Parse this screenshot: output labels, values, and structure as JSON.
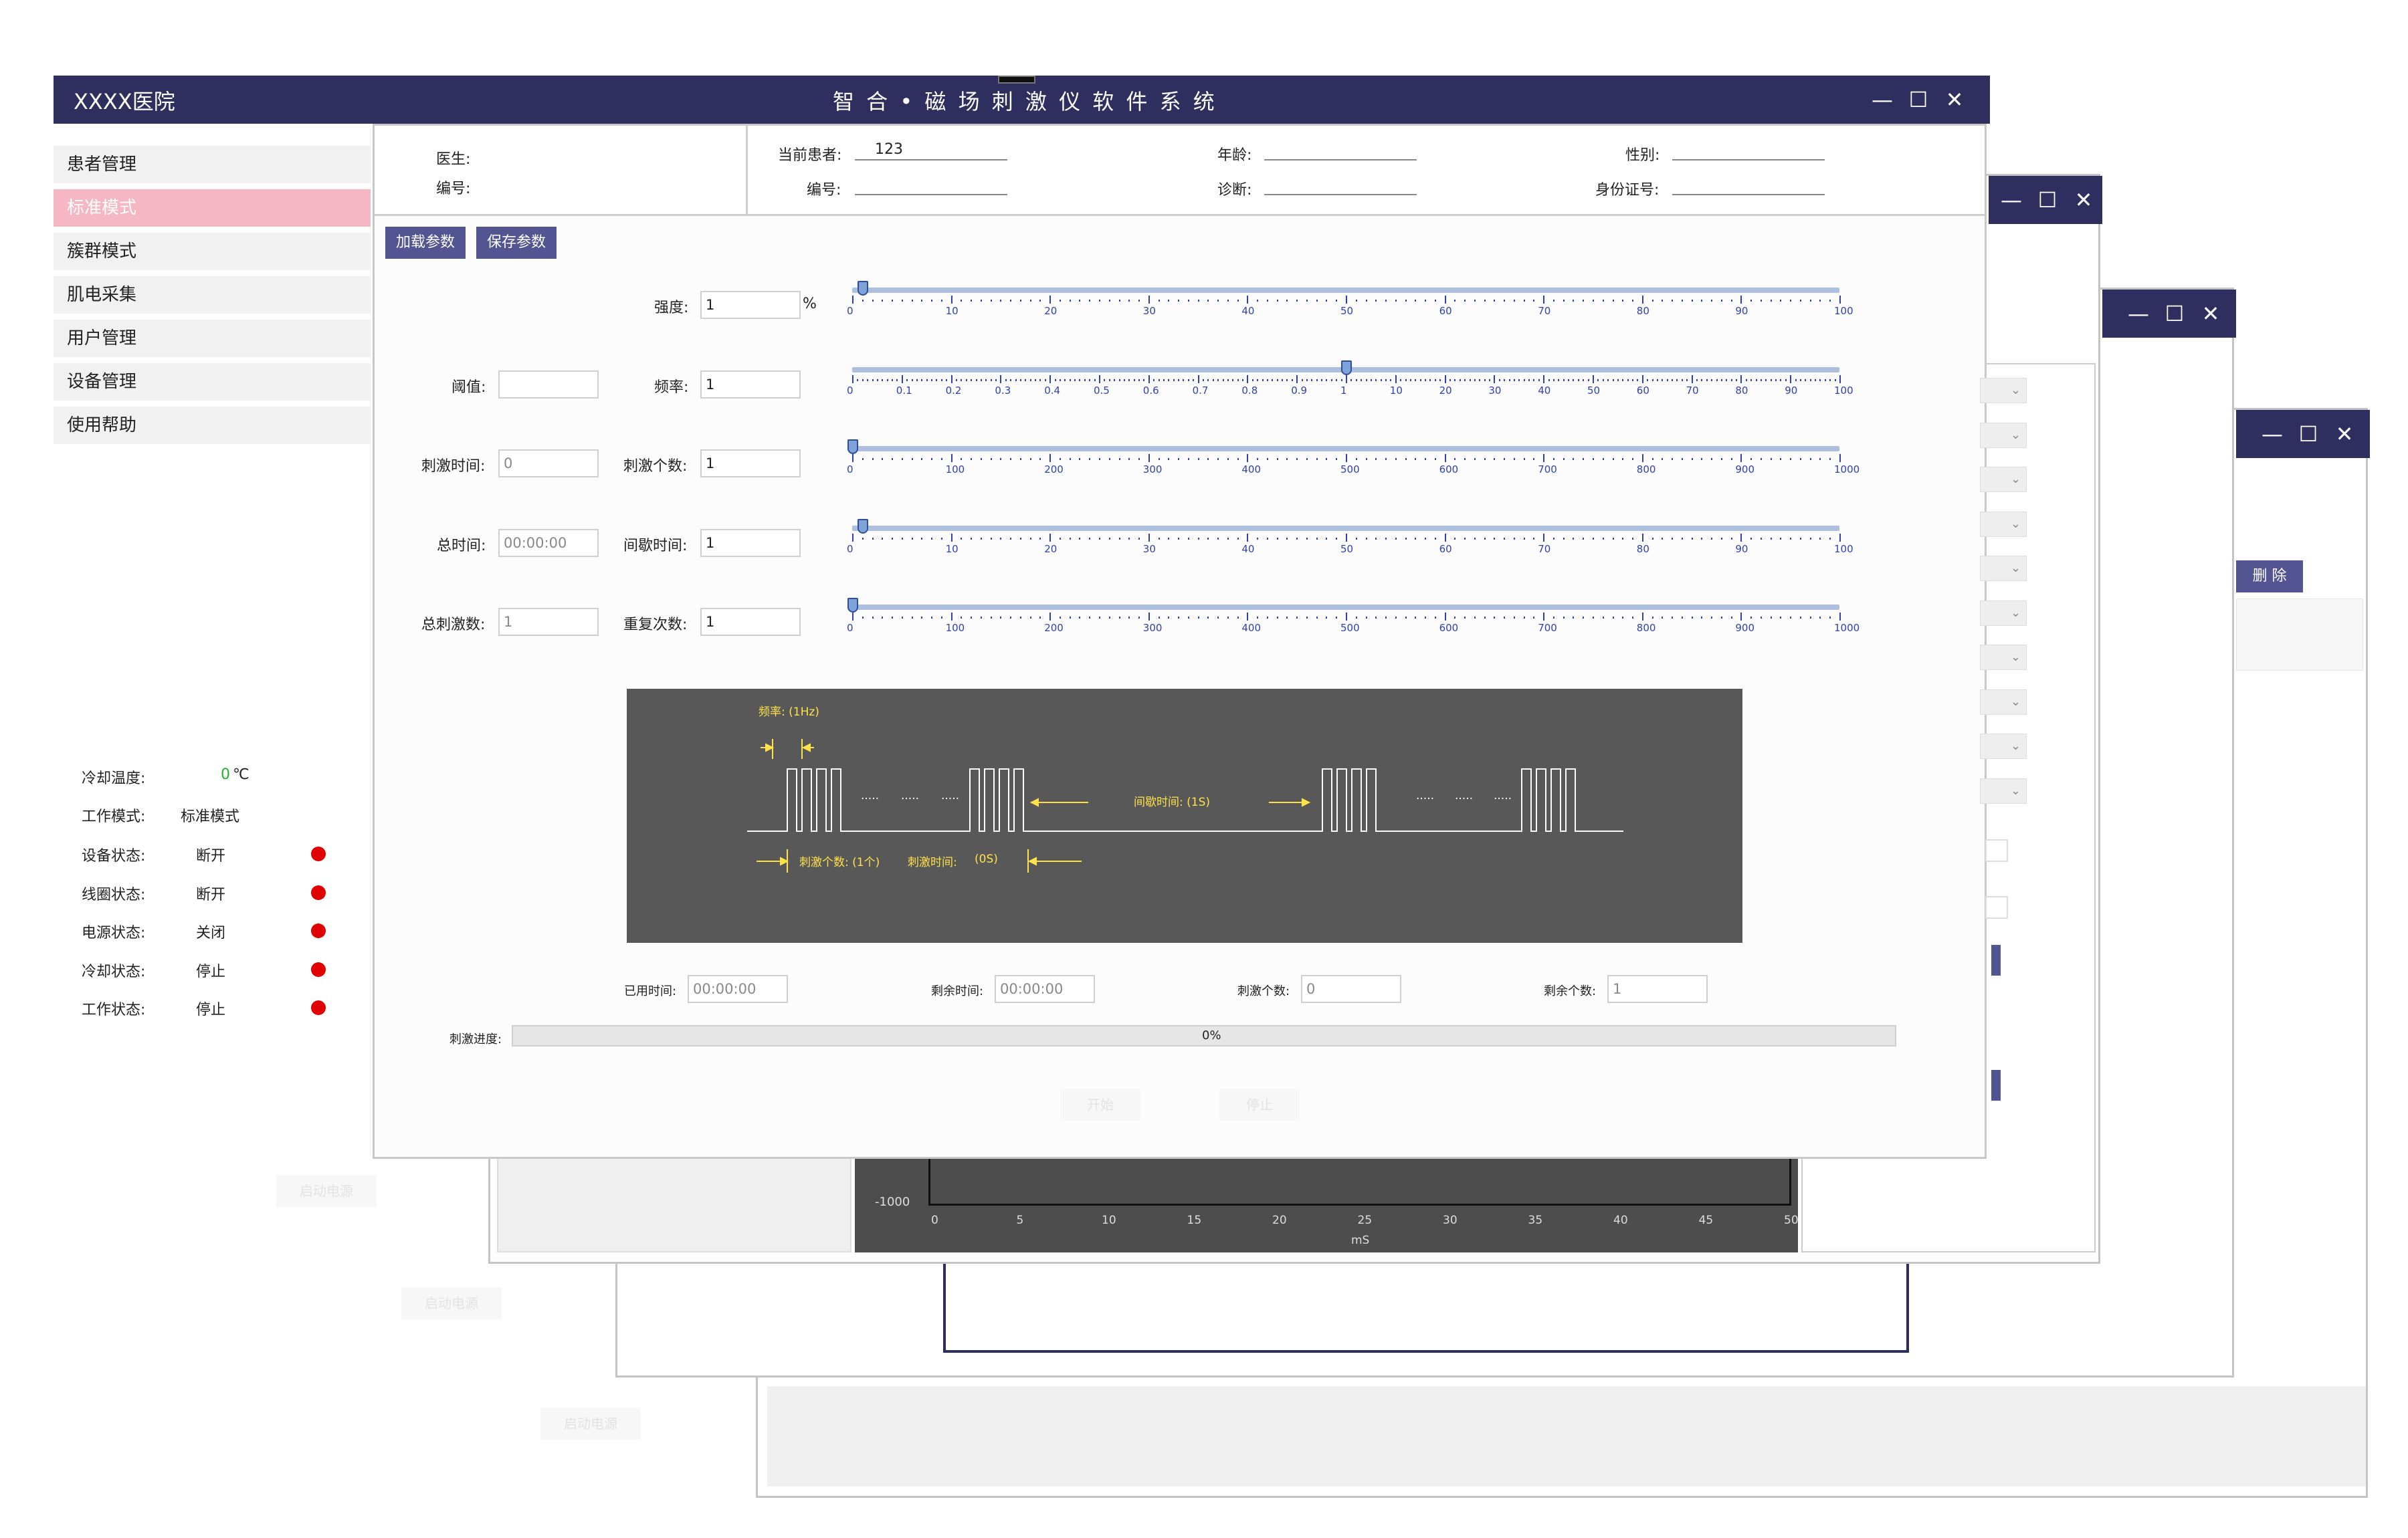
{
  "app": {
    "hospital": "XXXX医院",
    "title": "智 合 • 磁 场 刺 激 仪 软 件 系 统",
    "min_glyph": "—",
    "max_glyph": "☐",
    "close_glyph": "✕"
  },
  "sidebar": {
    "items": [
      {
        "label": "患者管理"
      },
      {
        "label": "标准模式",
        "active": true
      },
      {
        "label": "簇群模式"
      },
      {
        "label": "肌电采集"
      },
      {
        "label": "用户管理"
      },
      {
        "label": "设备管理"
      },
      {
        "label": "使用帮助"
      }
    ]
  },
  "status": {
    "cooling_temp_label": "冷却温度:",
    "cooling_temp_value": "0",
    "cooling_temp_unit": "℃",
    "work_mode_label": "工作模式:",
    "work_mode_value": "标准模式",
    "rows": [
      {
        "label": "设备状态:",
        "value": "断开"
      },
      {
        "label": "线圈状态:",
        "value": "断开"
      },
      {
        "label": "电源状态:",
        "value": "关闭"
      },
      {
        "label": "冷却状态:",
        "value": "停止"
      },
      {
        "label": "工作状态:",
        "value": "停止"
      }
    ],
    "start_power": "启动电源"
  },
  "patient": {
    "doctor_label": "医生:",
    "number_label": "编号:",
    "current_patient_label": "当前患者:",
    "current_patient_value": "123",
    "number2_label": "编号:",
    "age_label": "年龄:",
    "diagnosis_label": "诊断:",
    "sex_label": "性别:",
    "id_label": "身份证号:"
  },
  "toolbar": {
    "load": "加载参数",
    "save": "保存参数"
  },
  "params": {
    "strength_label": "强度:",
    "strength_value": "1",
    "strength_unit": "%",
    "threshold_label": "阈值:",
    "threshold_value": "",
    "frequency_label": "频率:",
    "frequency_value": "1",
    "stim_time_label": "刺激时间:",
    "stim_time_value": "0",
    "stim_count_label": "刺激个数:",
    "stim_count_value": "1",
    "total_time_label": "总时间:",
    "total_time_value": "00:00:00",
    "interval_label": "间歇时间:",
    "interval_value": "1",
    "total_stim_label": "总刺激数:",
    "total_stim_value": "1",
    "repeat_label": "重复次数:",
    "repeat_value": "1"
  },
  "sliders": [
    {
      "name": "strength",
      "ticks": [
        "0",
        "10",
        "20",
        "30",
        "40",
        "50",
        "60",
        "70",
        "80",
        "90",
        "100"
      ],
      "value": 1,
      "position": 0.01
    },
    {
      "name": "frequency",
      "ticks": [
        "0",
        "0.1",
        "0.2",
        "0.3",
        "0.4",
        "0.5",
        "0.6",
        "0.7",
        "0.8",
        "0.9",
        "1",
        "10",
        "20",
        "30",
        "40",
        "50",
        "60",
        "70",
        "80",
        "90",
        "100"
      ],
      "value": 1,
      "position": 0.5
    },
    {
      "name": "stim-count",
      "ticks": [
        "0",
        "100",
        "200",
        "300",
        "400",
        "500",
        "600",
        "700",
        "800",
        "900",
        "1000"
      ],
      "value": 1,
      "position": 0.0
    },
    {
      "name": "interval",
      "ticks": [
        "0",
        "10",
        "20",
        "30",
        "40",
        "50",
        "60",
        "70",
        "80",
        "90",
        "100"
      ],
      "value": 1,
      "position": 0.01
    },
    {
      "name": "repeat",
      "ticks": [
        "0",
        "100",
        "200",
        "300",
        "400",
        "500",
        "600",
        "700",
        "800",
        "900",
        "1000"
      ],
      "value": 1,
      "position": 0.0
    }
  ],
  "waveform": {
    "freq_label": "频率: (1Hz)",
    "interval_label": "间歇时间: (1S)",
    "stim_count_label": "刺激个数: (1个)",
    "stim_time_label": "刺激时间:",
    "stim_time_value": "(0S)",
    "ellipsis": "·····"
  },
  "progress": {
    "elapsed_label": "已用时间:",
    "elapsed_value": "00:00:00",
    "remaining_label": "剩余时间:",
    "remaining_value": "00:00:00",
    "stim_count_label": "刺激个数:",
    "stim_count_value": "0",
    "remaining_count_label": "剩余个数:",
    "remaining_count_value": "1",
    "bar_label": "刺激进度:",
    "bar_text": "0%",
    "bar_fraction": 0.0
  },
  "actions": {
    "start": "开始",
    "stop": "停止"
  },
  "background": {
    "delete": "删 除",
    "emg_y_label": "-1000",
    "emg_x_ticks": [
      "0",
      "5",
      "10",
      "15",
      "20",
      "25",
      "30",
      "35",
      "40",
      "45",
      "50"
    ],
    "emg_x_unit": "mS",
    "combo_glyph": "⌄"
  }
}
